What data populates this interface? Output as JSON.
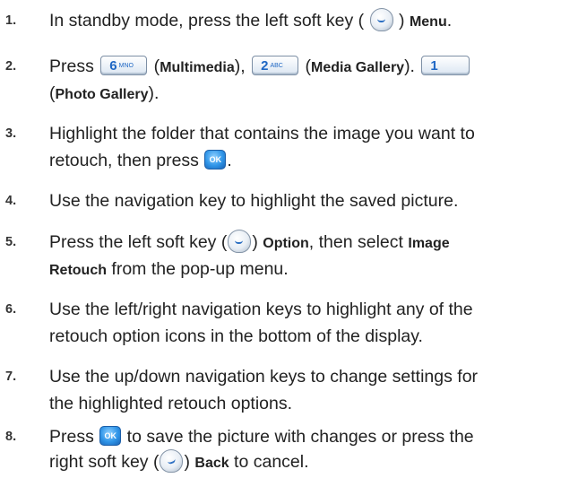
{
  "steps": [
    {
      "num": "1.",
      "lines": [
        "In standby mode, press the left soft key ( ",
        " ) ",
        "Menu",
        "."
      ]
    },
    {
      "num": "2.",
      "a": "Press ",
      "k6": "6",
      "k6sub": "MNO",
      "b": " (",
      "mm": "Multimedia",
      "c": "), ",
      "k2": "2",
      "k2sub": "ABC",
      "d": " (",
      "mg": "Media Gallery",
      "e": ").",
      "k1": "1",
      "k1sub": "",
      "l2a": "(",
      "pg": "Photo Gallery",
      "l2b": ")."
    },
    {
      "num": "3.",
      "l1": "Highlight the folder that contains the image you want to",
      "l2a": "retouch, then press ",
      "ok": "OK",
      "l2b": "."
    },
    {
      "num": "4.",
      "l1": "Use the navigation key to highlight the saved picture."
    },
    {
      "num": "5.",
      "a": "Press the left soft key (",
      "b": ") ",
      "opt": "Option",
      "c": ", then select ",
      "ir1": "Image",
      "ir2": "Retouch",
      "d": " from the pop-up menu."
    },
    {
      "num": "6.",
      "l1": "Use the left/right navigation keys to highlight any of the",
      "l2": "retouch option icons in the bottom of the display."
    },
    {
      "num": "7.",
      "l1": "Use the up/down navigation keys to change settings for",
      "l2": "the highlighted retouch options."
    },
    {
      "num": "8.",
      "a": "Press ",
      "ok": "OK",
      "b": " to save the picture with changes or press the",
      "c": "right soft key (",
      "d": ") ",
      "back": "Back",
      "e": " to cancel."
    }
  ]
}
